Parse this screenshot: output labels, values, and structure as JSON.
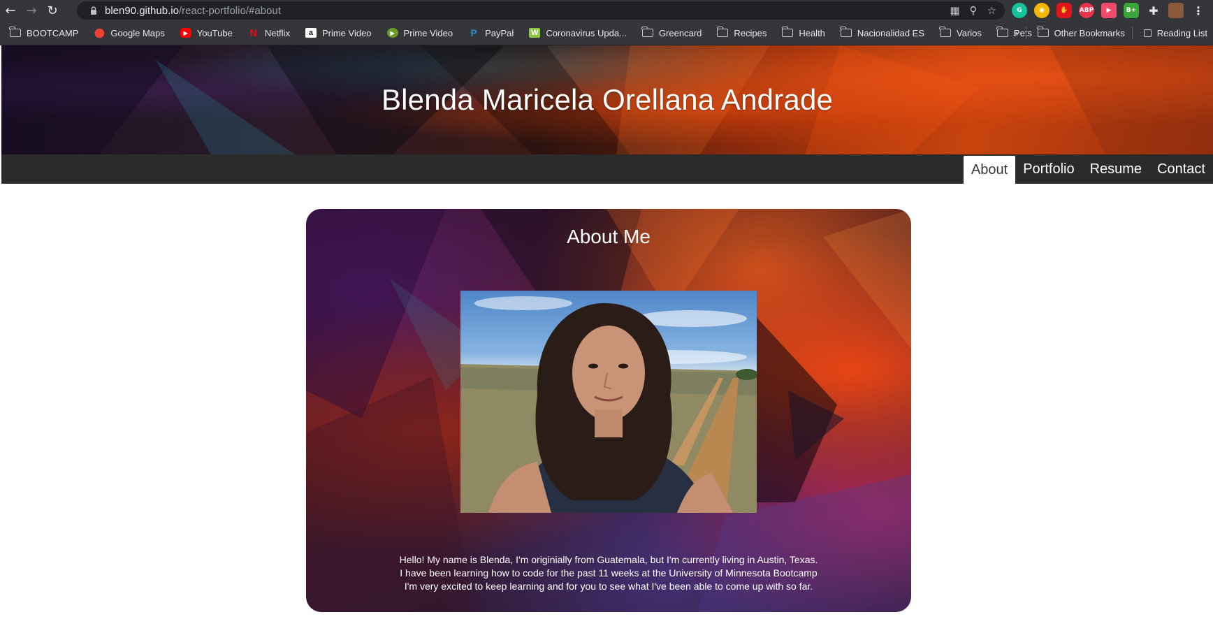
{
  "browser": {
    "url_host": "blen90.github.io",
    "url_path": "/react-portfolio/#about",
    "bookmarks": [
      {
        "label": "BOOTCAMP",
        "icon": "folder-icon"
      },
      {
        "label": "Google Maps",
        "icon": "google-maps-icon"
      },
      {
        "label": "YouTube",
        "icon": "youtube-icon"
      },
      {
        "label": "Netflix",
        "icon": "netflix-icon"
      },
      {
        "label": "Prime Video",
        "icon": "amazon-icon"
      },
      {
        "label": "Prime Video",
        "icon": "prime-video-icon"
      },
      {
        "label": "PayPal",
        "icon": "paypal-icon"
      },
      {
        "label": "Coronavirus Upda...",
        "icon": "coronavirus-icon"
      },
      {
        "label": "Greencard",
        "icon": "folder-icon"
      },
      {
        "label": "Recipes",
        "icon": "folder-icon"
      },
      {
        "label": "Health",
        "icon": "folder-icon"
      },
      {
        "label": "Nacionalidad ES",
        "icon": "folder-icon"
      },
      {
        "label": "Varios",
        "icon": "folder-icon"
      },
      {
        "label": "Pets",
        "icon": "folder-icon"
      }
    ],
    "overflow_label": "»",
    "other_bookmarks": "Other Bookmarks",
    "reading_list": "Reading List"
  },
  "header": {
    "title": "Blenda Maricela Orellana Andrade"
  },
  "nav": {
    "items": [
      {
        "label": "About",
        "active": true
      },
      {
        "label": "Portfolio",
        "active": false
      },
      {
        "label": "Resume",
        "active": false
      },
      {
        "label": "Contact",
        "active": false
      }
    ]
  },
  "about": {
    "title": "About Me",
    "bio_lines": [
      "Hello! My name is Blenda, I'm originially from Guatemala, but I'm currently living in Austin, Texas.",
      "I have been learning how to code for the past 11 weeks at the University of Minnesota Bootcamp",
      "I'm very excited to keep learning and for you to see what I've been able to come up with so far."
    ]
  },
  "colors": {
    "navbar": "#2b2b2b",
    "chrome": "#35363a",
    "active_tab_text": "#3a3a3a"
  }
}
